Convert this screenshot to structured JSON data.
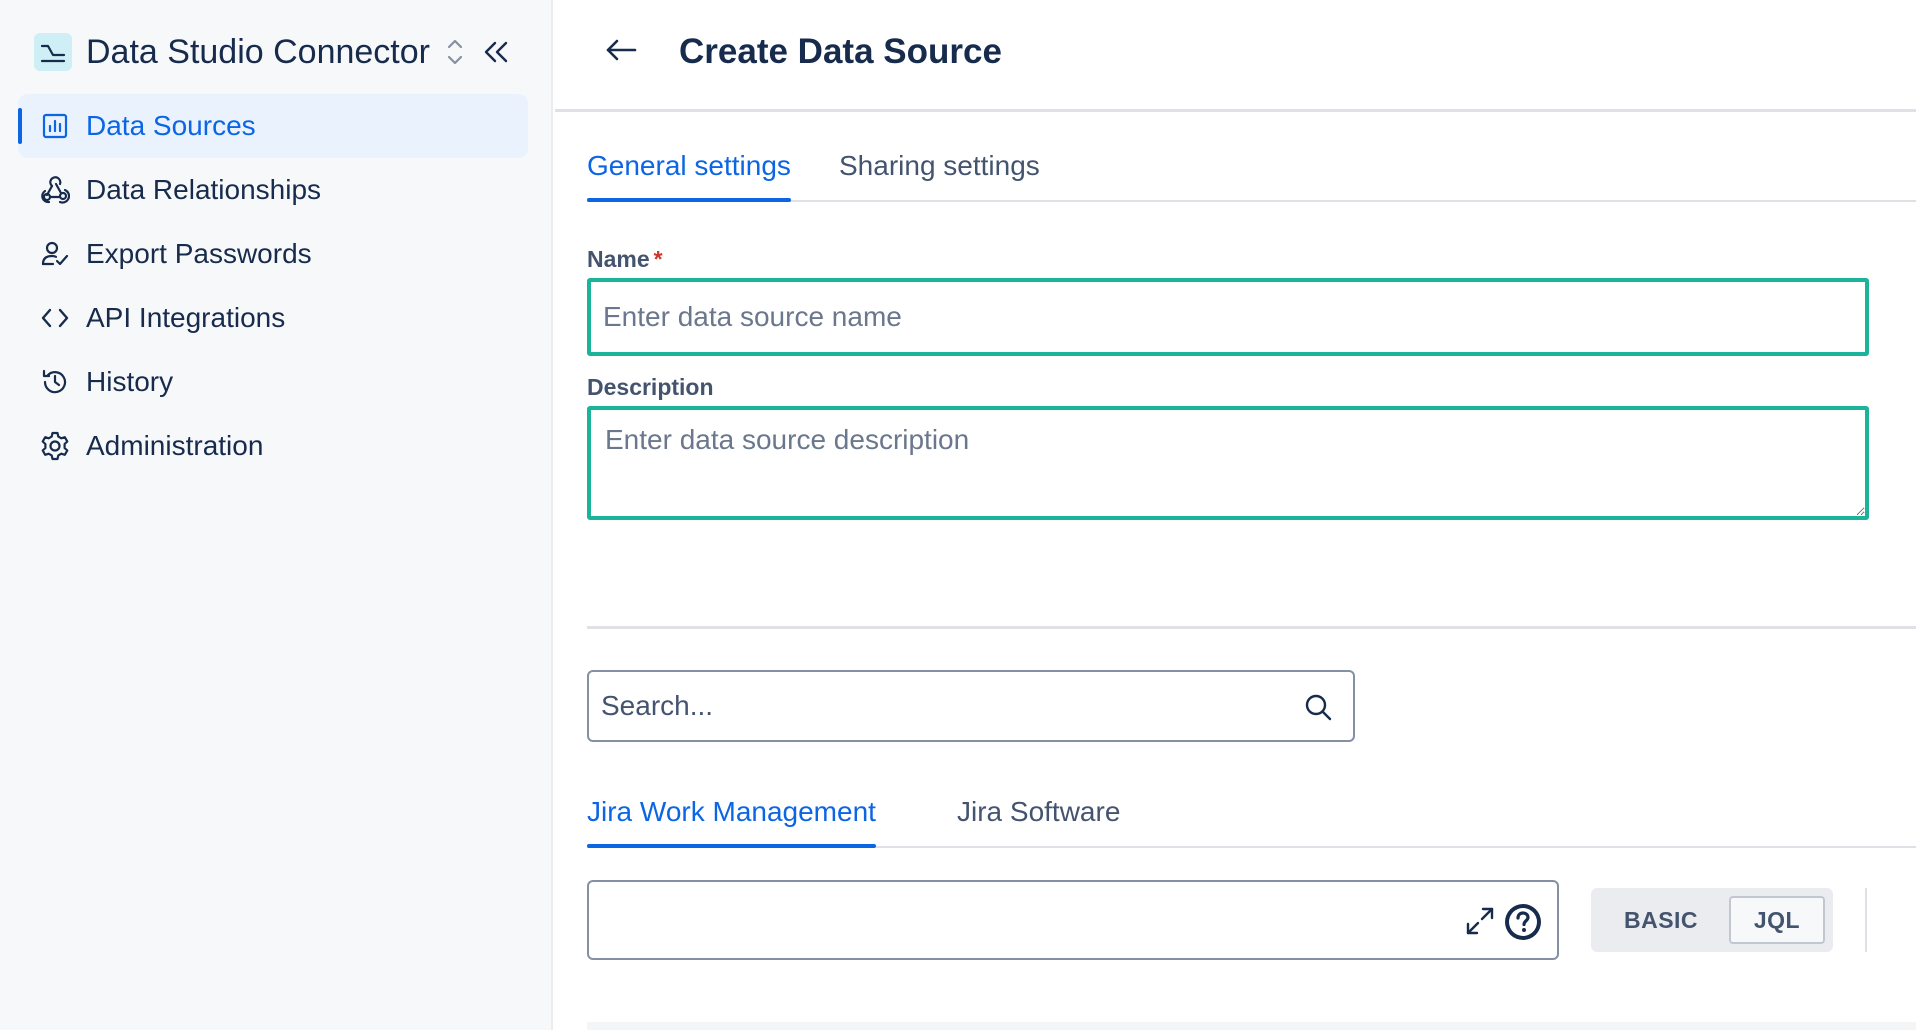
{
  "sidebar": {
    "app_title": "Data Studio Connector",
    "items": [
      {
        "label": "Data Sources",
        "icon": "bar-chart-icon",
        "active": true
      },
      {
        "label": "Data Relationships",
        "icon": "webhook-icon",
        "active": false
      },
      {
        "label": "Export Passwords",
        "icon": "user-check-icon",
        "active": false
      },
      {
        "label": "API Integrations",
        "icon": "code-icon",
        "active": false
      },
      {
        "label": "History",
        "icon": "history-icon",
        "active": false
      },
      {
        "label": "Administration",
        "icon": "gear-icon",
        "active": false
      }
    ]
  },
  "header": {
    "title": "Create Data Source"
  },
  "settings_tabs": [
    {
      "label": "General settings",
      "active": true
    },
    {
      "label": "Sharing settings",
      "active": false
    }
  ],
  "form": {
    "name": {
      "label": "Name",
      "required_mark": "*",
      "placeholder": "Enter data source name",
      "value": ""
    },
    "description": {
      "label": "Description",
      "placeholder": "Enter data source description",
      "value": ""
    }
  },
  "search": {
    "placeholder": "Search...",
    "value": ""
  },
  "source_tabs": [
    {
      "label": "Jira Work Management",
      "active": true
    },
    {
      "label": "Jira Software",
      "active": false
    }
  ],
  "query": {
    "value": "",
    "modes": [
      "BASIC",
      "JQL"
    ],
    "selected_mode": "JQL"
  },
  "colors": {
    "accent": "#0c66e4",
    "focus_border": "#1bb39a",
    "required": "#c9372c",
    "sidebar_bg": "#f7f8f9",
    "active_item_bg": "#e9f2fd"
  }
}
